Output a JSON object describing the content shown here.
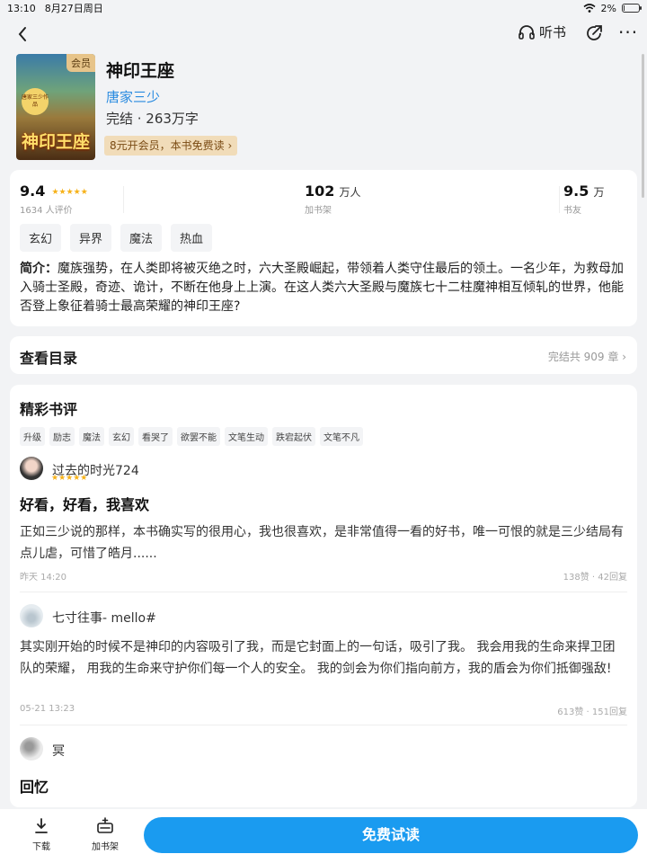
{
  "status": {
    "time": "13:10",
    "date": "8月27日周日",
    "battery": "2%",
    "battery_level": 0.02
  },
  "nav": {
    "listen_label": "听书"
  },
  "book": {
    "title": "神印王座",
    "author": "唐家三少",
    "meta": "完结 · 263万字",
    "vip_tag": "会员",
    "vip_promo": "8元开会员，本书免费读 ›",
    "cover_title": "神印王座",
    "cover_seal": "唐家三少作品"
  },
  "stats": {
    "rating": "9.4",
    "rating_stars": "★★★★★",
    "rating_count": "1634 人评价",
    "shelf_num": "102",
    "shelf_unit": "万人",
    "shelf_label": "加书架",
    "fans_num": "9.5",
    "fans_unit": "万",
    "fans_label": "书友"
  },
  "tags": [
    "玄幻",
    "异界",
    "魔法",
    "热血"
  ],
  "intro": {
    "label": "简介：",
    "text": "魔族强势，在人类即将被灭绝之时，六大圣殿崛起，带领着人类守住最后的领土。一名少年，为救母加入骑士圣殿，奇迹、诡计，不断在他身上上演。在这人类六大圣殿与魔族七十二柱魔神相互倾轧的世界，他能否登上象征着骑士最高荣耀的神印王座?"
  },
  "toc": {
    "title": "查看目录",
    "info": "完结共 909 章  ›"
  },
  "reviews_section": {
    "title": "精彩书评",
    "tags": [
      "升级",
      "励志",
      "魔法",
      "玄幻",
      "看哭了",
      "欲罢不能",
      "文笔生动",
      "跌宕起伏",
      "文笔不凡"
    ]
  },
  "reviews": [
    {
      "user": "过去的时光724",
      "stars": "★★★★★",
      "headline": "好看，好看，我喜欢",
      "body": "正如三少说的那样，本书确实写的很用心，我也很喜欢，是非常值得一看的好书，唯一可恨的就是三少结局有点儿虐，可惜了皓月......",
      "date": "昨天 14:20",
      "stat": "138赞 · 42回复"
    },
    {
      "user": "七寸往事- mello#",
      "headline": "",
      "body": "其实刚开始的时候不是神印的内容吸引了我，而是它封面上的一句话，吸引了我。          我会用我的生命来捍卫团队的荣耀，   用我的生命来守护你们每一个人的安全。          我的剑会为你们指向前方，我的盾会为你们抵御强敌!",
      "date": "05-21 13:23",
      "stat": "613赞 · 151回复"
    },
    {
      "user": "冥",
      "headline": "回忆",
      "body": "",
      "date": "",
      "stat": ""
    }
  ],
  "bottom": {
    "download": "下载",
    "shelf": "加书架",
    "read": "免费试读"
  },
  "colors": {
    "accent": "#1a9bf0",
    "author": "#2a8be0",
    "star": "#f6b21a",
    "vip": "#f1dcb9"
  }
}
